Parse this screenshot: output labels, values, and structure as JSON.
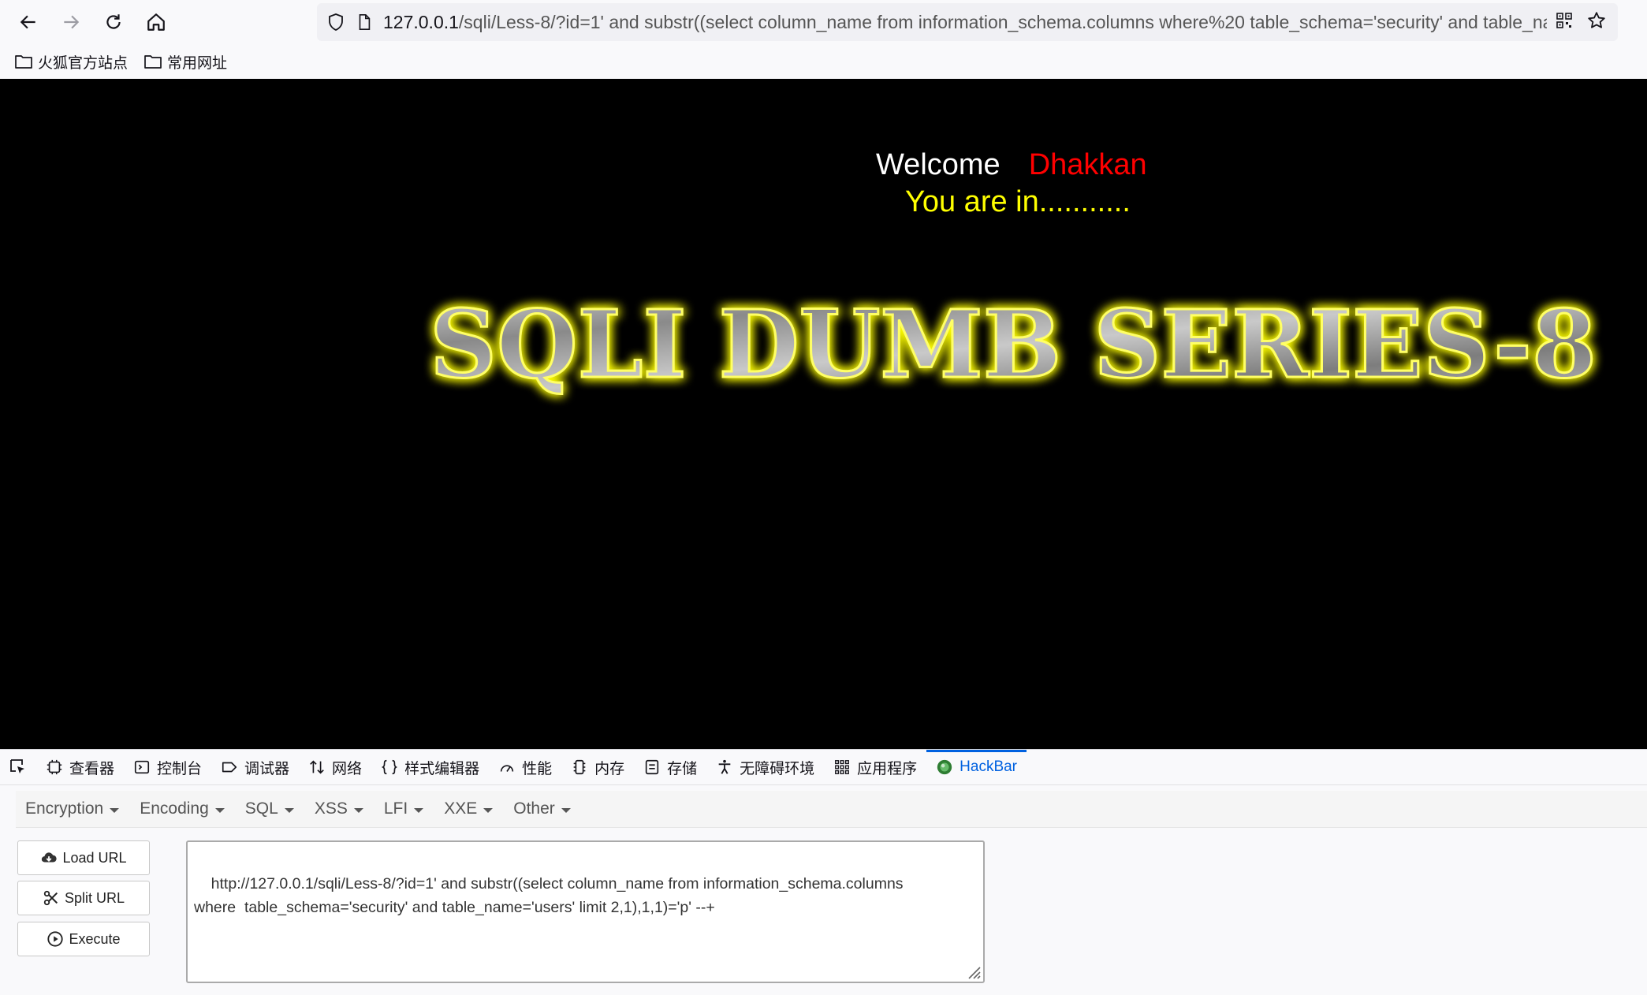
{
  "browser": {
    "url": {
      "host": "127.0.0.1",
      "path": "/sqli/Less-8/?id=1' and substr((select column_name from information_schema.columns where%20 table_schema='security' and table_name="
    },
    "bookmarks": [
      {
        "label": "火狐官方站点",
        "icon": "folder-icon"
      },
      {
        "label": "常用网址",
        "icon": "folder-icon"
      }
    ]
  },
  "page": {
    "welcome_word": "Welcome",
    "welcome_name": "Dhakkan",
    "status_text": "You are in...........",
    "banner_text": "SQLI DUMB SERIES-8",
    "colors": {
      "background": "#000000",
      "welcome": "#ffffff",
      "name": "#ff0000",
      "status": "#ffff00",
      "banner_glow": "#ffff00"
    }
  },
  "devtools": {
    "tabs": [
      {
        "label": "查看器",
        "icon": "inspector-icon"
      },
      {
        "label": "控制台",
        "icon": "console-icon"
      },
      {
        "label": "调试器",
        "icon": "debugger-icon"
      },
      {
        "label": "网络",
        "icon": "network-icon"
      },
      {
        "label": "样式编辑器",
        "icon": "style-editor-icon"
      },
      {
        "label": "性能",
        "icon": "performance-icon"
      },
      {
        "label": "内存",
        "icon": "memory-icon"
      },
      {
        "label": "存储",
        "icon": "storage-icon"
      },
      {
        "label": "无障碍环境",
        "icon": "accessibility-icon"
      },
      {
        "label": "应用程序",
        "icon": "application-icon"
      },
      {
        "label": "HackBar",
        "icon": "hackbar-icon",
        "active": true
      }
    ],
    "active_color": "#0061e0"
  },
  "hackbar": {
    "menu": [
      "Encryption",
      "Encoding",
      "SQL",
      "XSS",
      "LFI",
      "XXE",
      "Other"
    ],
    "buttons": {
      "load": "Load URL",
      "split": "Split URL",
      "execute": "Execute"
    },
    "url_value": "http://127.0.0.1/sqli/Less-8/?id=1' and substr((select column_name from information_schema.columns\nwhere  table_schema='security' and table_name='users' limit 2,1),1,1)='p' --+"
  }
}
